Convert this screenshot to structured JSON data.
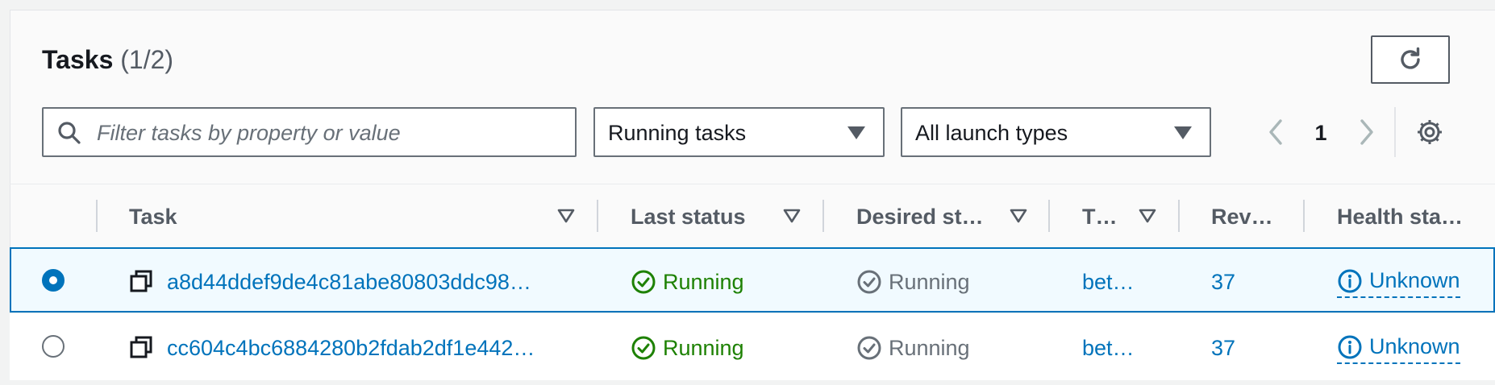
{
  "header": {
    "title": "Tasks",
    "count": "(1/2)"
  },
  "toolbar": {
    "search_placeholder": "Filter tasks by property or value",
    "status_filter": "Running tasks",
    "launch_filter": "All launch types",
    "page": "1"
  },
  "table": {
    "columns": [
      "Task",
      "Last status",
      "Desired st…",
      "T…",
      "Rev…",
      "Health sta…"
    ],
    "rows": [
      {
        "selected": true,
        "task": "a8d44ddef9de4c81abe80803ddc98…",
        "last_status": "Running",
        "desired_status": "Running",
        "task_def": "bet…",
        "revision": "37",
        "health": "Unknown"
      },
      {
        "selected": false,
        "task": "cc604c4bc6884280b2fdab2df1e442…",
        "last_status": "Running",
        "desired_status": "Running",
        "task_def": "bet…",
        "revision": "37",
        "health": "Unknown"
      }
    ]
  },
  "colors": {
    "link": "#0073bb",
    "success": "#1d8102",
    "muted": "#687078",
    "selected_bg": "#f1faff"
  },
  "icons": {
    "refresh": "refresh-icon",
    "search": "search-icon",
    "caret": "caret-down-icon",
    "prev": "chevron-left-icon",
    "next": "chevron-right-icon",
    "settings": "gear-icon",
    "sort": "sort-triangle-icon",
    "copy": "copy-icon",
    "status_ok": "check-circle-icon",
    "status_neutral": "check-circle-outline-icon",
    "info": "info-circle-icon"
  }
}
